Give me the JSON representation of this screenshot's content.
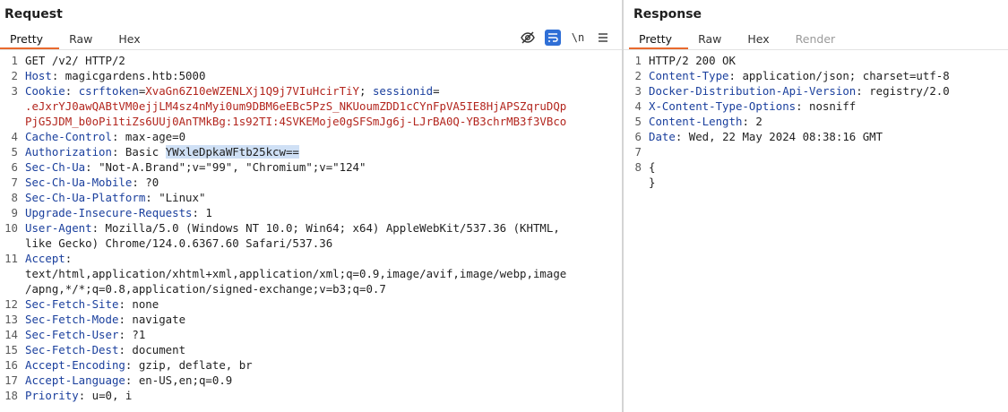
{
  "request": {
    "title": "Request",
    "tabs": [
      "Pretty",
      "Raw",
      "Hex"
    ],
    "toolbar": {
      "newline_label": "\\n"
    },
    "line_numbers": [
      "1",
      "2",
      "3",
      "",
      "",
      "4",
      "5",
      "6",
      "7",
      "8",
      "9",
      "10",
      "",
      "11",
      "",
      "",
      "12",
      "13",
      "14",
      "15",
      "16",
      "17",
      "18"
    ],
    "l1": "GET /v2/ HTTP/2",
    "host_key": "Host",
    "host_val": "magicgardens.htb:5000",
    "cookie_key": "Cookie",
    "csrf_name": "csrftoken",
    "csrf_val": "XvaGn6Z10eWZENLXj1Q9j7VIuHcirTiY",
    "sess_name": "sessionid",
    "sess_val1": ".eJxrYJ0awQABtVM0ejjLM4sz4nMyi0um9DBM6eEBc5PzS_NKUoumZDD1cCYnFpVA5IE8HjAPSZqruDQp",
    "sess_val2": "PjG5JDM_b0oPi1tiZs6UUj0AnTMkBg:1s92TI:4SVKEMoje0gSFSmJg6j-LJrBA0Q-YB3chrMB3f3VBco",
    "cache_key": "Cache-Control",
    "cache_val": "max-age=0",
    "auth_key": "Authorization",
    "auth_scheme": "Basic",
    "auth_val": "YWxleDpkaWFtb25kcw==",
    "ua_key": "Sec-Ch-Ua",
    "ua_val": "\"Not-A.Brand\";v=\"99\", \"Chromium\";v=\"124\"",
    "mobile_key": "Sec-Ch-Ua-Mobile",
    "mobile_val": "?0",
    "platform_key": "Sec-Ch-Ua-Platform",
    "platform_val": "\"Linux\"",
    "uir_key": "Upgrade-Insecure-Requests",
    "uir_val": "1",
    "agent_key": "User-Agent",
    "agent_val1": "Mozilla/5.0 (Windows NT 10.0; Win64; x64) AppleWebKit/537.36 (KHTML,",
    "agent_val2": "like Gecko) Chrome/124.0.6367.60 Safari/537.36",
    "accept_key": "Accept",
    "accept_val1": "text/html,application/xhtml+xml,application/xml;q=0.9,image/avif,image/webp,image",
    "accept_val2": "/apng,*/*;q=0.8,application/signed-exchange;v=b3;q=0.7",
    "site_key": "Sec-Fetch-Site",
    "site_val": "none",
    "mode_key": "Sec-Fetch-Mode",
    "mode_val": "navigate",
    "user_key": "Sec-Fetch-User",
    "user_val": "?1",
    "dest_key": "Sec-Fetch-Dest",
    "dest_val": "document",
    "enc_key": "Accept-Encoding",
    "enc_val": "gzip, deflate, br",
    "lang_key": "Accept-Language",
    "lang_val": "en-US,en;q=0.9",
    "prio_key": "Priority",
    "prio_val": "u=0, i"
  },
  "response": {
    "title": "Response",
    "tabs": [
      "Pretty",
      "Raw",
      "Hex",
      "Render"
    ],
    "line_numbers": [
      "1",
      "2",
      "3",
      "4",
      "5",
      "6",
      "7",
      "8",
      ""
    ],
    "l1": "HTTP/2 200 OK",
    "ct_key": "Content-Type",
    "ct_val": "application/json; charset=utf-8",
    "dd_key": "Docker-Distribution-Api-Version",
    "dd_val": "registry/2.0",
    "xc_key": "X-Content-Type-Options",
    "xc_val": "nosniff",
    "cl_key": "Content-Length",
    "cl_val": "2",
    "date_key": "Date",
    "date_val": "Wed, 22 May 2024 08:38:16 GMT",
    "body_open": "{",
    "body_close": "}"
  },
  "colors": {
    "accent": "#e86a2e",
    "header_key": "#1a3f9d",
    "cookie_value": "#b3261e",
    "selection": "#cfe0f5"
  }
}
